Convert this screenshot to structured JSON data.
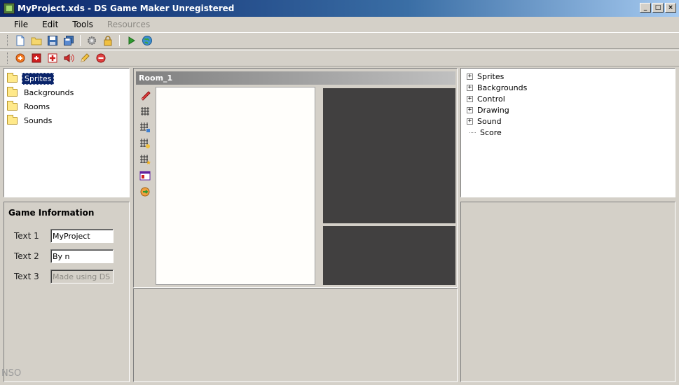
{
  "window": {
    "title": "MyProject.xds - DS Game Maker Unregistered",
    "controls": [
      "_",
      "□",
      "×"
    ]
  },
  "menu": [
    {
      "label": "File",
      "enabled": true
    },
    {
      "label": "Edit",
      "enabled": true
    },
    {
      "label": "Tools",
      "enabled": true
    },
    {
      "label": "Resources",
      "enabled": false
    }
  ],
  "toolbar_main": [
    "new-file-icon",
    "open-folder-icon",
    "save-icon",
    "save-all-icon",
    "gear-icon",
    "lock-icon",
    "play-icon",
    "globe-icon"
  ],
  "toolbar_resources": [
    "add-sprite-icon",
    "add-background-icon",
    "add-room-icon",
    "add-sound-icon",
    "edit-pencil-icon",
    "delete-icon"
  ],
  "resources": {
    "items": [
      {
        "label": "Sprites",
        "selected": true
      },
      {
        "label": "Backgrounds",
        "selected": false
      },
      {
        "label": "Rooms",
        "selected": false
      },
      {
        "label": "Sounds",
        "selected": false
      }
    ]
  },
  "game_info": {
    "title": "Game Information",
    "text1_label": "Text 1",
    "text1_value": "MyProject",
    "text2_label": "Text 2",
    "text2_value": "By n",
    "text3_label": "Text 3",
    "text3_value": "Made using DS"
  },
  "room": {
    "title": "Room_1",
    "tools": [
      "eraser-icon",
      "grid-icon",
      "grid-select-icon",
      "grid-snap-icon",
      "grid-star-icon",
      "room-window-icon",
      "refresh-arrow-icon"
    ]
  },
  "actions_tree": {
    "items": [
      {
        "label": "Sprites",
        "expandable": true
      },
      {
        "label": "Backgrounds",
        "expandable": true
      },
      {
        "label": "Control",
        "expandable": true
      },
      {
        "label": "Drawing",
        "expandable": true
      },
      {
        "label": "Sound",
        "expandable": true
      },
      {
        "label": "Score",
        "expandable": false
      }
    ]
  },
  "watermark": "NSO"
}
